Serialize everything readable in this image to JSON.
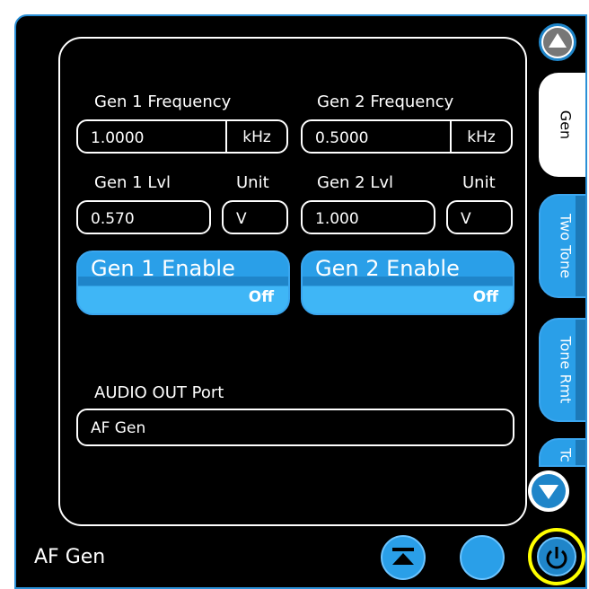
{
  "gen1": {
    "freq_label": "Gen 1 Frequency",
    "freq_value": "1.0000",
    "freq_unit": "kHz",
    "lvl_label": "Gen 1 Lvl",
    "lvl_value": "0.570",
    "unit_label": "Unit",
    "unit_value": "V",
    "enable_label": "Gen 1 Enable",
    "enable_state": "Off"
  },
  "gen2": {
    "freq_label": "Gen 2 Frequency",
    "freq_value": "0.5000",
    "freq_unit": "kHz",
    "lvl_label": "Gen 2 Lvl",
    "lvl_value": "1.000",
    "unit_label": "Unit",
    "unit_value": "V",
    "enable_label": "Gen 2 Enable",
    "enable_state": "Off"
  },
  "audio_out": {
    "label": "AUDIO OUT Port",
    "value": "AF Gen"
  },
  "tabs": [
    {
      "label": "Gen",
      "active": true
    },
    {
      "label": "Two Tone",
      "active": false
    },
    {
      "label": "Tone Rmt",
      "active": false
    },
    {
      "label": "Tc",
      "active": false
    }
  ],
  "footer": {
    "title": "AF Gen"
  },
  "icons": {
    "scroll_up": "scroll-up-icon",
    "scroll_down": "scroll-down-icon",
    "collapse": "collapse-icon",
    "blank_button": "blank-circle-icon",
    "power": "power-icon"
  },
  "colors": {
    "accent_blue": "#2a9fe8",
    "frame_blue": "#2a8fd6",
    "highlight_ring": "#ffff00",
    "background": "#000000",
    "text": "#ffffff"
  }
}
